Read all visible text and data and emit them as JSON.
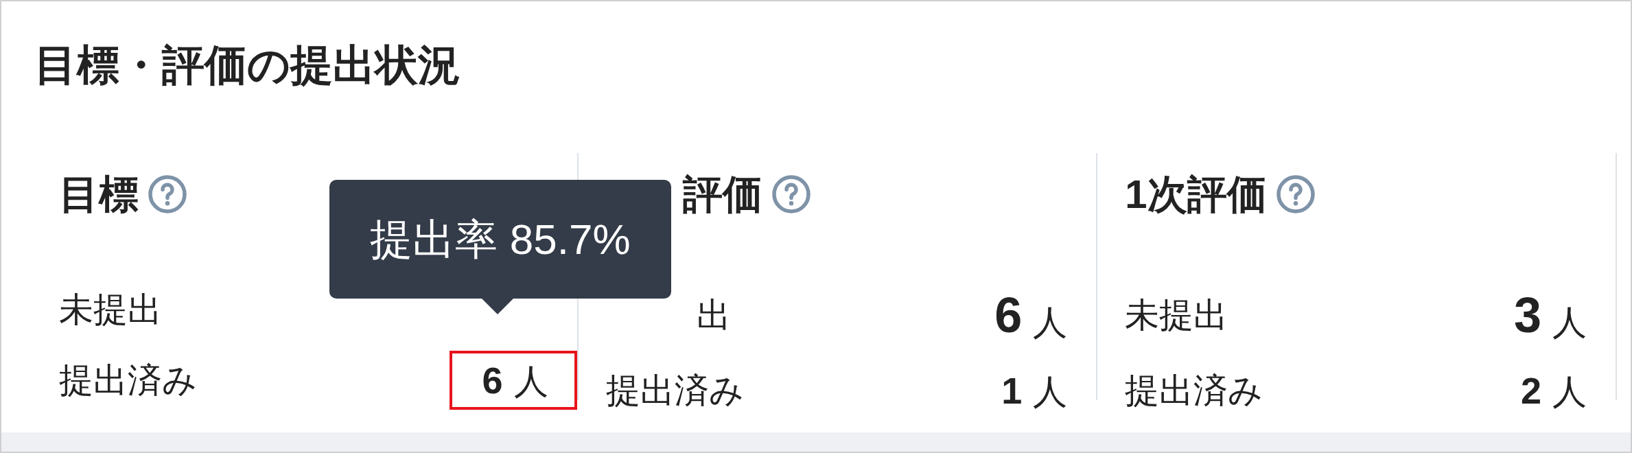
{
  "title": "目標・評価の提出状況",
  "columns": [
    {
      "title": "目標",
      "rows": [
        {
          "label": "未提出"
        },
        {
          "label": "提出済み",
          "count": "6",
          "unit": "人",
          "highlighted": true
        }
      ],
      "tooltip": "提出率 85.7%"
    },
    {
      "title": "評価",
      "rows": [
        {
          "label": "出",
          "count": "6",
          "unit": "人",
          "highlighted": false
        },
        {
          "label": "提出済み",
          "count": "1",
          "unit": "人",
          "highlighted": false
        }
      ]
    },
    {
      "title": "1次評価",
      "rows": [
        {
          "label": "未提出",
          "count": "3",
          "unit": "人",
          "highlighted": false
        },
        {
          "label": "提出済み",
          "count": "2",
          "unit": "人",
          "highlighted": false
        }
      ]
    }
  ]
}
